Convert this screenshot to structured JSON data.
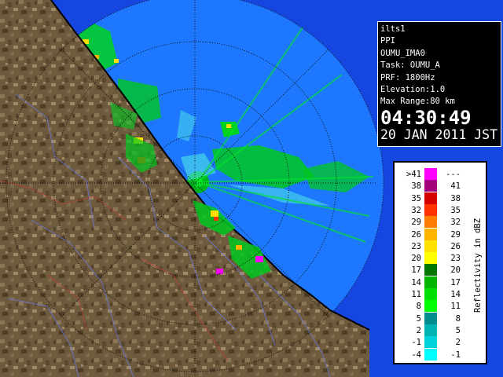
{
  "info": {
    "radar": "ilts1",
    "product": "PPI",
    "task_name": "OUMU_IMA0",
    "task": "Task: OUMU_A",
    "prf": "PRF: 1800Hz",
    "elevation": "Elevation:1.0",
    "max_range": "Max Range:80 km",
    "time": "04:30:49",
    "date": "20 JAN 2011 JST"
  },
  "legend": {
    "unit": "Reflectivity in dBZ",
    "bins": [
      {
        "left": ">41",
        "right": "---",
        "color": "#ff00ff"
      },
      {
        "left": "38",
        "right": "41",
        "color": "#a0007a"
      },
      {
        "left": "35",
        "right": "38",
        "color": "#d40000"
      },
      {
        "left": "32",
        "right": "35",
        "color": "#ff3200"
      },
      {
        "left": "29",
        "right": "32",
        "color": "#ff7d00"
      },
      {
        "left": "26",
        "right": "29",
        "color": "#ffb400"
      },
      {
        "left": "23",
        "right": "26",
        "color": "#ffe000"
      },
      {
        "left": "20",
        "right": "23",
        "color": "#ffff00"
      },
      {
        "left": "17",
        "right": "20",
        "color": "#007800"
      },
      {
        "left": "14",
        "right": "17",
        "color": "#00b400"
      },
      {
        "left": "11",
        "right": "14",
        "color": "#00e000"
      },
      {
        "left": "8",
        "right": "11",
        "color": "#00ff00"
      },
      {
        "left": "5",
        "right": "8",
        "color": "#008c8c"
      },
      {
        "left": "2",
        "right": "5",
        "color": "#00b4b4"
      },
      {
        "left": "-1",
        "right": "2",
        "color": "#00d2dc"
      },
      {
        "left": "-4",
        "right": "-1",
        "color": "#00ffff"
      }
    ]
  },
  "map": {
    "sea_color": "#1646e0",
    "scan_area_color": "#1e78ff",
    "land_color": "#6e5a3c"
  }
}
